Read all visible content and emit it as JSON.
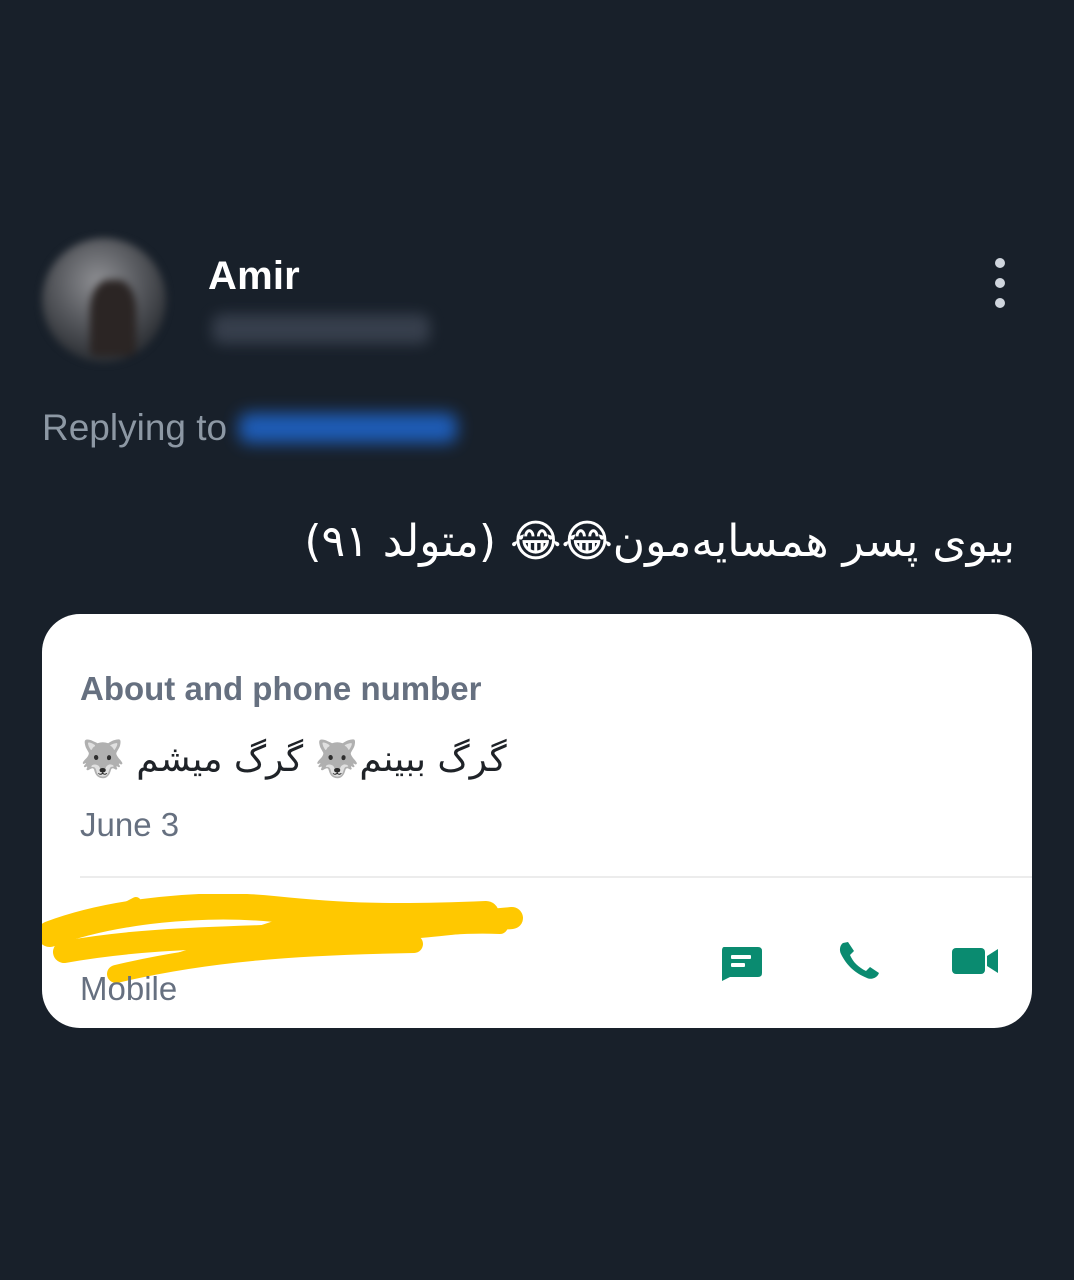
{
  "post": {
    "author_name": "Amir",
    "replying_label": "Replying to",
    "text": "بیوی پسر همسایه‌مون😂😂 (متولد ۹۱)"
  },
  "card": {
    "title": "About and phone number",
    "about_text": "گرگ ببینم🐺 گرگ میشم 🐺",
    "date": "June 3",
    "phone_type": "Mobile",
    "actions": {
      "message_icon": "message-icon",
      "call_icon": "phone-icon",
      "video_icon": "video-icon"
    }
  },
  "colors": {
    "background": "#18202a",
    "card_background": "#ffffff",
    "accent_green": "#0a8b70",
    "redaction_yellow": "#ffc800"
  }
}
